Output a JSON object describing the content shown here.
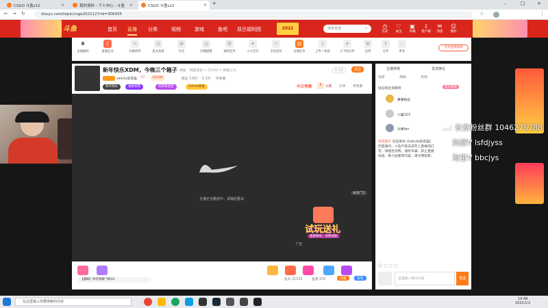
{
  "browser": {
    "tabs": [
      {
        "title": "CSGO 斗鱼s12"
      },
      {
        "title": "我的资料 - 个人中心 - 斗鱼"
      },
      {
        "title": "CSGO 斗鱼s12"
      }
    ],
    "new_tab": "+",
    "url": "douyu.com/topic/csgo2021127rid=306935"
  },
  "header": {
    "logo": "斗鱼",
    "nav": [
      "首页",
      "直播",
      "分类",
      "视频",
      "游戏",
      "鱼吧",
      "双旦福利团"
    ],
    "promo_year": "2022",
    "search_placeholder": "搜索直播",
    "icons": [
      "历史",
      "关注",
      "开播",
      "客户端",
      "消息",
      "我的"
    ]
  },
  "toolbar": {
    "level": "6",
    "items": [
      "主播福利",
      "直播互动",
      "贡献榜单",
      "鱼丸商城",
      "礼包",
      "开播提醒",
      "福利任务",
      "火力全开",
      "全民狂欢",
      "主播任务",
      "上传一条视",
      "小飞机分享",
      "应用",
      "分享",
      "更多"
    ],
    "fan_button": "点亮金牌勋章"
  },
  "stream": {
    "title": "新年快乐XDM，今晚三个箱子",
    "report": "举报",
    "category": "网游竞技 > CS:GO > 刚刚上头",
    "anchor": "sakula黑夜猫",
    "level": "10",
    "tag": "CS:GO",
    "fans": "粉丝 3.8万",
    "follow": "关注",
    "follow_count": "5.3万",
    "today_rank_label": "今日导播",
    "today_rank": "1",
    "hot": "火箭",
    "share": "分享",
    "mobile": "手机看",
    "badges": [
      "新年快乐",
      "福星高照",
      "成就粉丝团",
      "Sakula家族"
    ],
    "loading_text": "主播正在路途中，请稍后重试",
    "ad_label": "广告",
    "ad_close": "关闭广告",
    "ad_text": "试玩送礼",
    "ad_sub": "直接畅玩，免费领取"
  },
  "bottom": {
    "recharge": "充值",
    "barrage_label": "【通知】",
    "barrage_text": "你可领取飞机X1",
    "gifts": [
      "荧光棒",
      "办卡",
      "弹幕",
      "火箭",
      "飞机"
    ],
    "fish_ball": "鱼丸 22133",
    "fish_fin": "鱼翅 200",
    "charge": "充值",
    "bag": "背包"
  },
  "sidebar": {
    "tab1": "主播排榜",
    "tab2": "贵宾席位",
    "tab3": "直播间",
    "rank_tabs": [
      "日榜",
      "周榜",
      "月榜"
    ],
    "title": "钻石粉丝贡献榜",
    "apply": "成为高能",
    "fans": [
      {
        "name": "某某粉丝"
      },
      {
        "name": "小猫123"
      },
      {
        "name": "头像fan"
      }
    ],
    "notice_label": "系统提示",
    "notice": "欢迎来到【sakula黑夜猫】的直播间，斗鱼严禁未成年人直播或打赏，请理性消费，谨防诈骗，禁止直播低俗、暴力血腥等内容，请文明观看。",
    "chat_placeholder": "这里输入聊天内容",
    "send": "发送"
  },
  "overlay": {
    "lines": [
      "...: 长安粉丝群 1046275788",
      "剑叔V  lsfdjyss",
      "淘宝V  bbcjys"
    ]
  },
  "taskbar": {
    "search_placeholder": "在这里输入你要搜索的内容",
    "time": "19:48",
    "date": "2022/1/1"
  },
  "colors": {
    "brand": "#d9251c",
    "accent": "#ff7a1a"
  }
}
